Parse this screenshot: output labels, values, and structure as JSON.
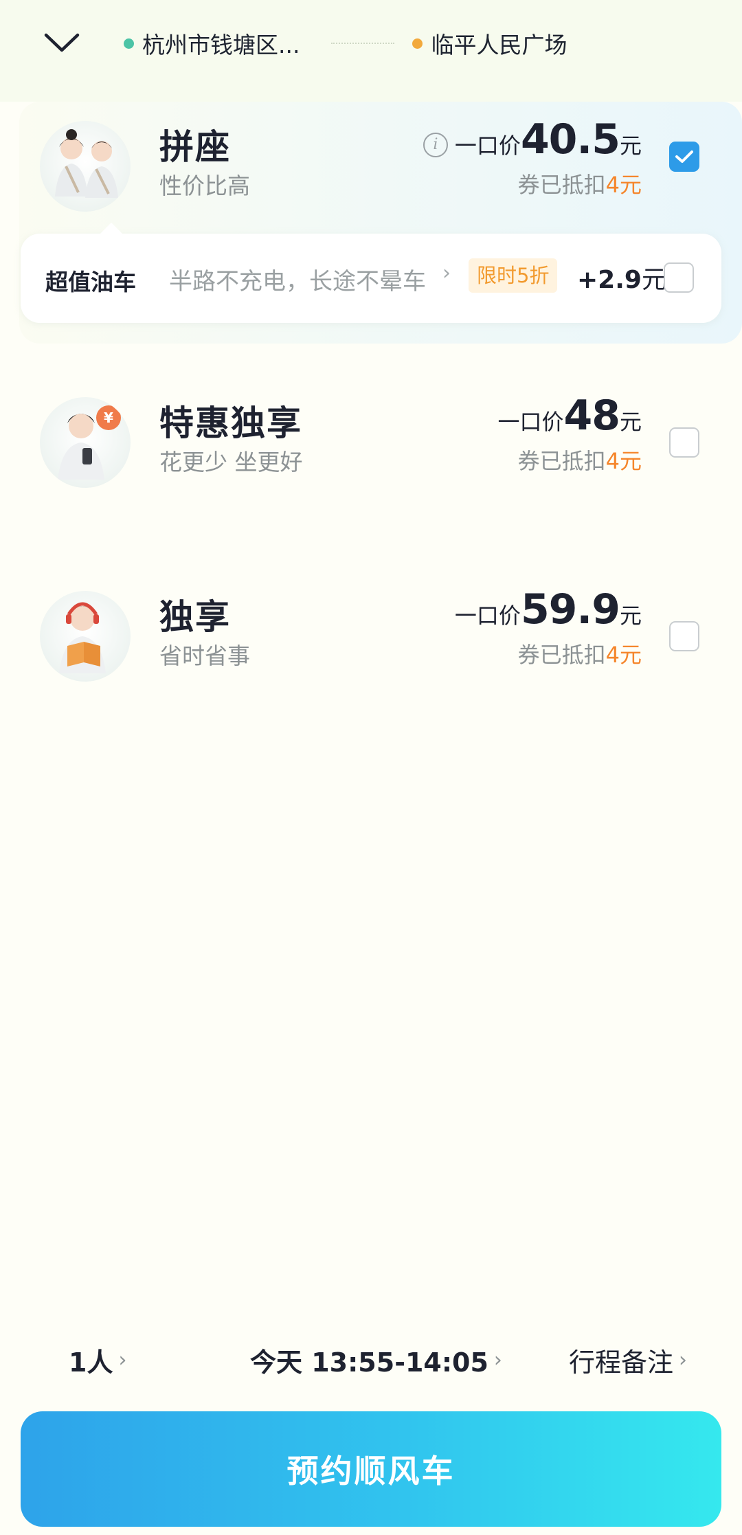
{
  "header": {
    "origin": "杭州市钱塘区...",
    "destination": "临平人民广场",
    "origin_color": "#4cc4a6",
    "destination_color": "#f2a93c"
  },
  "options": [
    {
      "title": "拼座",
      "subtitle": "性价比高",
      "price_prefix": "一口价",
      "price": "40.5",
      "price_unit": "元",
      "coupon_text": "券已抵扣",
      "coupon_amount": "4元",
      "checked": true
    },
    {
      "title": "特惠独享",
      "subtitle": "花更少 坐更好",
      "price_prefix": "一口价",
      "price": "48",
      "price_unit": "元",
      "coupon_text": "券已抵扣",
      "coupon_amount": "4元",
      "checked": false
    },
    {
      "title": "独享",
      "subtitle": "省时省事",
      "price_prefix": "一口价",
      "price": "59.9",
      "price_unit": "元",
      "coupon_text": "券已抵扣",
      "coupon_amount": "4元",
      "checked": false
    }
  ],
  "addon": {
    "title": "超值油车",
    "desc": "半路不充电，长途不晕车",
    "badge": "限时5折",
    "price": "+2.9",
    "price_unit": "元",
    "checked": false
  },
  "bottom": {
    "passengers": "1人",
    "time": "今天 13:55-14:05",
    "note": "行程备注",
    "submit": "预约顺风车"
  },
  "colors": {
    "accent": "#2d9be8",
    "coupon": "#f5862c",
    "badge_bg": "#fff3df"
  }
}
